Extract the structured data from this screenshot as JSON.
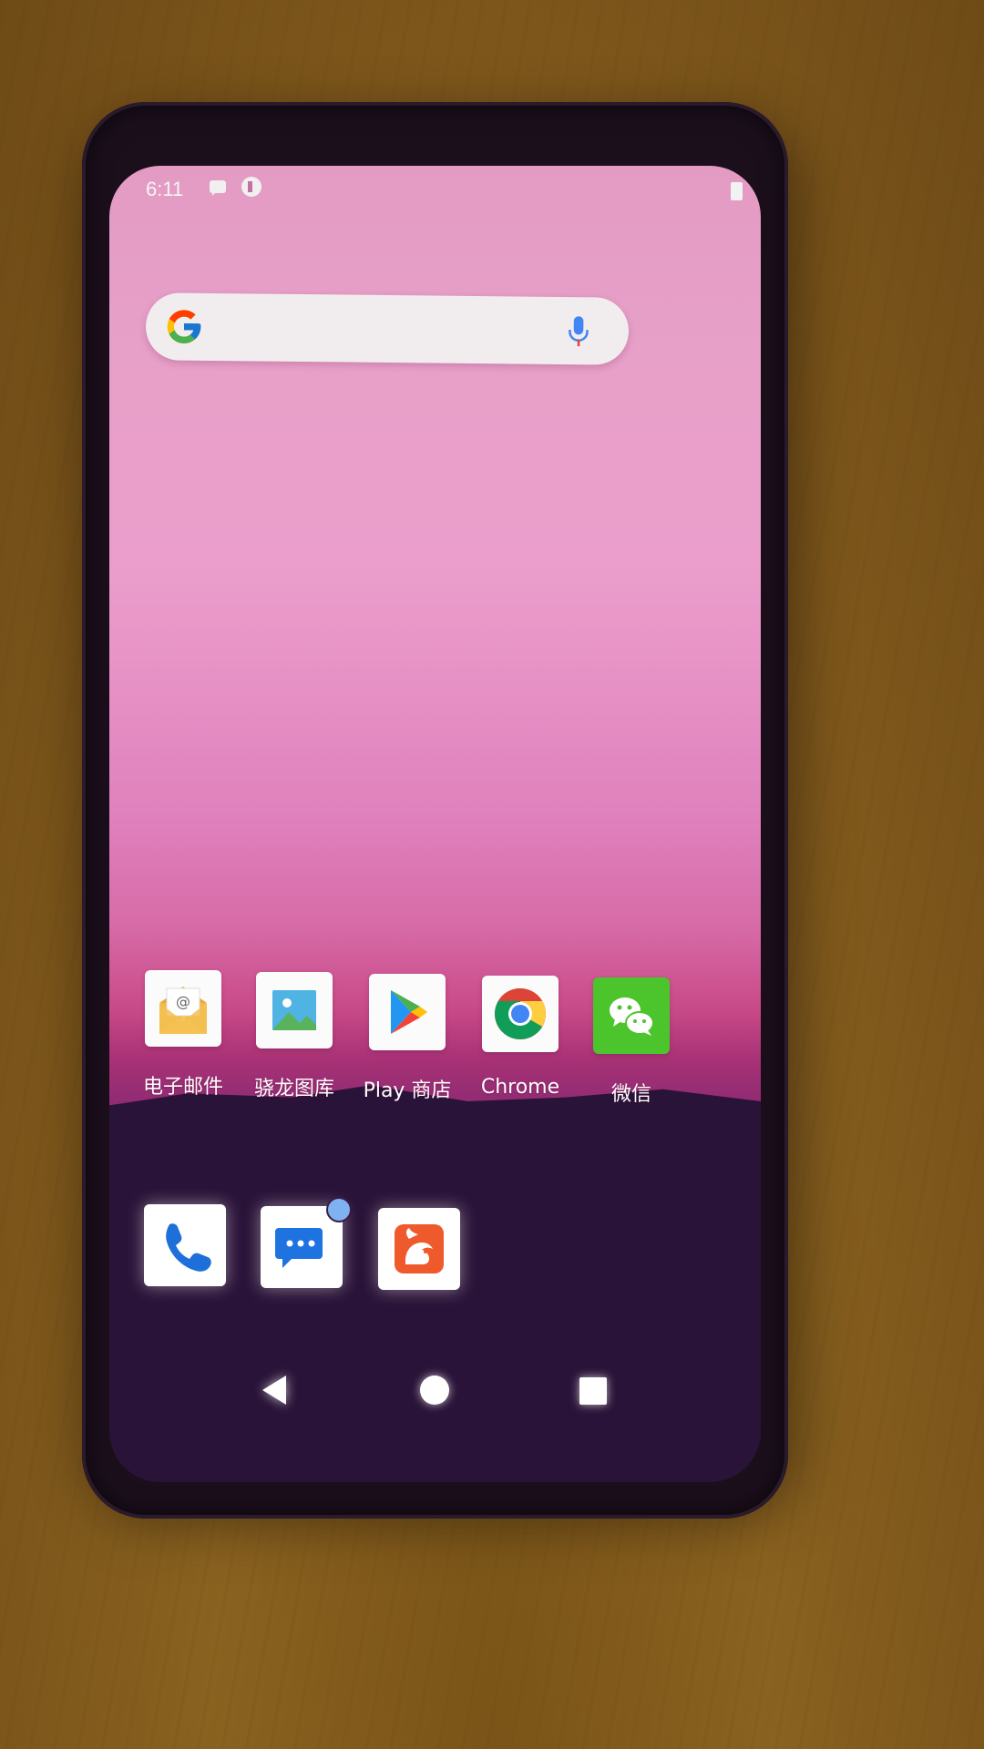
{
  "status_bar": {
    "time": "6:11",
    "icons": [
      "message-notification-icon",
      "app-notification-icon",
      "battery-icon"
    ]
  },
  "search_widget": {
    "logo": "google-g-icon",
    "voice": "microphone-icon"
  },
  "home_apps": [
    {
      "label": "电子邮件",
      "icon": "email-icon"
    },
    {
      "label": "骁龙图库",
      "icon": "gallery-icon"
    },
    {
      "label": "Play 商店",
      "icon": "play-store-icon"
    },
    {
      "label": "Chrome",
      "icon": "chrome-icon"
    },
    {
      "label": "微信",
      "icon": "wechat-icon"
    }
  ],
  "dock_apps": [
    {
      "icon": "phone-icon",
      "badge": false
    },
    {
      "icon": "messaging-icon",
      "badge": true
    },
    {
      "icon": "uc-browser-icon",
      "badge": false
    }
  ],
  "navigation": {
    "buttons": [
      "back-icon",
      "home-icon",
      "recents-icon"
    ]
  },
  "colors": {
    "wallpaper_top": "#e39bc3",
    "wallpaper_middle": "#d66aa6",
    "wallpaper_bottom": "#2a1036",
    "wechat_green": "#4cc42b",
    "phone_blue": "#1e6fd9",
    "uc_orange": "#ef5a2c"
  }
}
